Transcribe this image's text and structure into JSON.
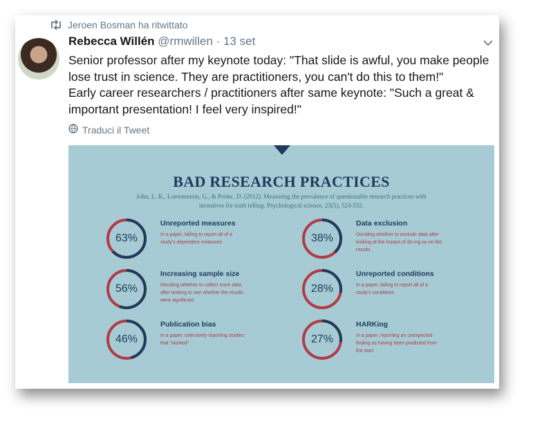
{
  "retweet": {
    "text": "Jeroen Bosman ha ritwittato",
    "icon": "retweet-icon"
  },
  "tweet": {
    "name": "Rebecca Willén",
    "handle": "@rmwillen · 13 set",
    "lines": [
      "Senior professor after my keynote today: \"That slide is awful, you make people",
      "lose trust in science. They are practitioners, you can't do this to them!\"",
      "Early career researchers / practitioners after same keynote: \"Such a great &",
      "important presentation! I feel very inspired!\""
    ],
    "translate": "Traduci il Tweet"
  },
  "infographic": {
    "title": "BAD RESEARCH PRACTICES",
    "citation_1": "John, L. K., Loewenstein, G., & Prelec, D. (2012). Measuring the prevalence of questionable research practices with",
    "citation_2": "incentives for truth telling. Psychological science, 23(5), 524-532.",
    "stats": [
      {
        "pct": "63%",
        "value": 0.63,
        "title": "Unreported measures",
        "desc": "In a paper, failing to report all of a study's dependent measures"
      },
      {
        "pct": "38%",
        "value": 0.38,
        "title": "Data exclusion",
        "desc": "Deciding whether to exclude data after looking at the impact of do-ing so on the results"
      },
      {
        "pct": "56%",
        "value": 0.56,
        "title": "Increasing sample size",
        "desc": "Deciding whether to collect more data after looking to see whether the results were significant"
      },
      {
        "pct": "28%",
        "value": 0.28,
        "title": "Unreported conditions",
        "desc": "In a paper, failing to report all of a study's conditions"
      },
      {
        "pct": "46%",
        "value": 0.46,
        "title": "Publication bias",
        "desc": "In a paper, selectively reporting studies that \"worked\""
      },
      {
        "pct": "27%",
        "value": 0.27,
        "title": "HARKing",
        "desc": "In a paper, reporting an unexpected finding as having been predicted from the start"
      }
    ],
    "colors": {
      "background": "#a6cbd4",
      "navy": "#1f3a5c",
      "red": "#b13a46"
    }
  }
}
